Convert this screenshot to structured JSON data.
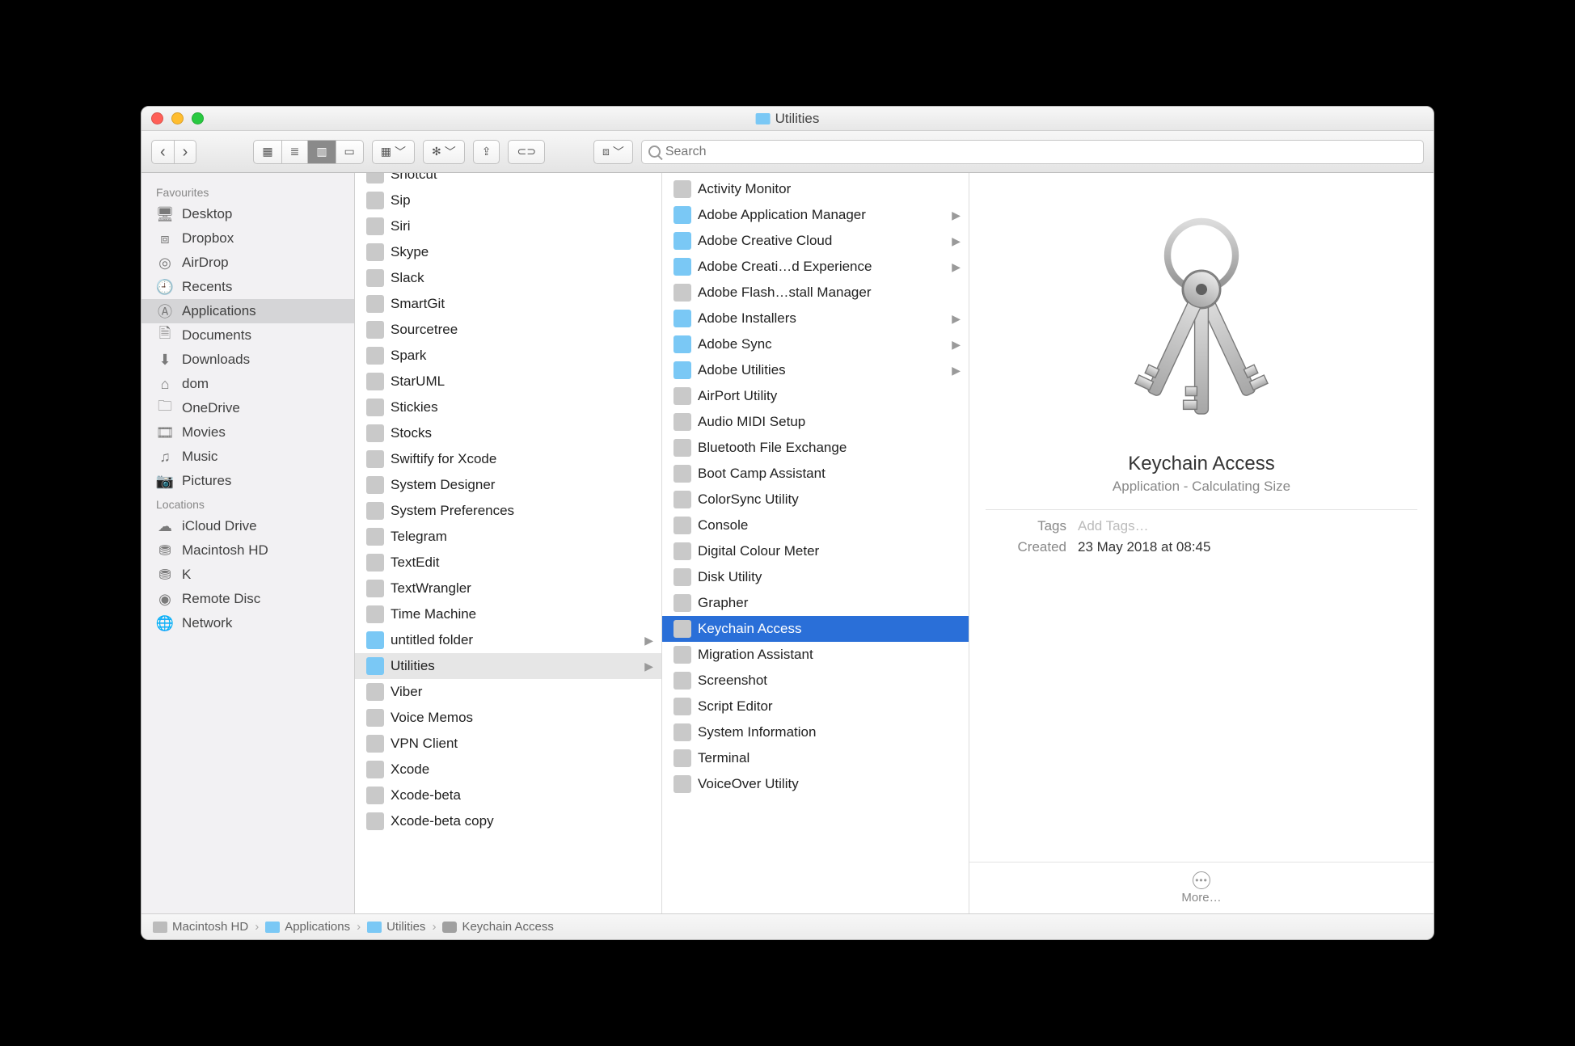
{
  "window": {
    "title": "Utilities"
  },
  "toolbar": {
    "search_placeholder": "Search"
  },
  "sidebar": {
    "sections": [
      {
        "title": "Favourites",
        "items": [
          {
            "label": "Desktop",
            "icon": "desktop"
          },
          {
            "label": "Dropbox",
            "icon": "dropbox"
          },
          {
            "label": "AirDrop",
            "icon": "airdrop"
          },
          {
            "label": "Recents",
            "icon": "recents"
          },
          {
            "label": "Applications",
            "icon": "applications",
            "selected": true
          },
          {
            "label": "Documents",
            "icon": "documents"
          },
          {
            "label": "Downloads",
            "icon": "downloads"
          },
          {
            "label": "dom",
            "icon": "home"
          },
          {
            "label": "OneDrive",
            "icon": "folder"
          },
          {
            "label": "Movies",
            "icon": "movies"
          },
          {
            "label": "Music",
            "icon": "music"
          },
          {
            "label": "Pictures",
            "icon": "pictures"
          }
        ]
      },
      {
        "title": "Locations",
        "items": [
          {
            "label": "iCloud Drive",
            "icon": "icloud"
          },
          {
            "label": "Macintosh HD",
            "icon": "hd"
          },
          {
            "label": "K",
            "icon": "hd"
          },
          {
            "label": "Remote Disc",
            "icon": "disc"
          },
          {
            "label": "Network",
            "icon": "network"
          }
        ]
      }
    ]
  },
  "columns": {
    "col1": [
      {
        "label": "Shotcut"
      },
      {
        "label": "Sip"
      },
      {
        "label": "Siri"
      },
      {
        "label": "Skype"
      },
      {
        "label": "Slack"
      },
      {
        "label": "SmartGit"
      },
      {
        "label": "Sourcetree"
      },
      {
        "label": "Spark"
      },
      {
        "label": "StarUML"
      },
      {
        "label": "Stickies"
      },
      {
        "label": "Stocks"
      },
      {
        "label": "Swiftify for Xcode"
      },
      {
        "label": "System Designer"
      },
      {
        "label": "System Preferences"
      },
      {
        "label": "Telegram"
      },
      {
        "label": "TextEdit"
      },
      {
        "label": "TextWrangler"
      },
      {
        "label": "Time Machine"
      },
      {
        "label": "untitled folder",
        "folder": true
      },
      {
        "label": "Utilities",
        "folder": true,
        "selected": true
      },
      {
        "label": "Viber"
      },
      {
        "label": "Voice Memos"
      },
      {
        "label": "VPN Client"
      },
      {
        "label": "Xcode"
      },
      {
        "label": "Xcode-beta"
      },
      {
        "label": "Xcode-beta copy"
      }
    ],
    "col2": [
      {
        "label": "Activity Monitor"
      },
      {
        "label": "Adobe Application Manager",
        "folder": true
      },
      {
        "label": "Adobe Creative Cloud",
        "folder": true
      },
      {
        "label": "Adobe Creati…d Experience",
        "folder": true
      },
      {
        "label": "Adobe Flash…stall Manager"
      },
      {
        "label": "Adobe Installers",
        "folder": true
      },
      {
        "label": "Adobe Sync",
        "folder": true
      },
      {
        "label": "Adobe Utilities",
        "folder": true
      },
      {
        "label": "AirPort Utility"
      },
      {
        "label": "Audio MIDI Setup"
      },
      {
        "label": "Bluetooth File Exchange"
      },
      {
        "label": "Boot Camp Assistant"
      },
      {
        "label": "ColorSync Utility"
      },
      {
        "label": "Console"
      },
      {
        "label": "Digital Colour Meter"
      },
      {
        "label": "Disk Utility"
      },
      {
        "label": "Grapher"
      },
      {
        "label": "Keychain Access",
        "selected": true
      },
      {
        "label": "Migration Assistant"
      },
      {
        "label": "Screenshot"
      },
      {
        "label": "Script Editor"
      },
      {
        "label": "System Information"
      },
      {
        "label": "Terminal"
      },
      {
        "label": "VoiceOver Utility"
      }
    ]
  },
  "preview": {
    "title": "Keychain Access",
    "subtitle": "Application - Calculating Size",
    "tags_label": "Tags",
    "tags_placeholder": "Add Tags…",
    "created_label": "Created",
    "created_value": "23 May 2018 at 08:45",
    "more_label": "More…"
  },
  "pathbar": {
    "segments": [
      {
        "label": "Macintosh HD",
        "icon": "hd"
      },
      {
        "label": "Applications",
        "icon": "folder"
      },
      {
        "label": "Utilities",
        "icon": "folder"
      },
      {
        "label": "Keychain Access",
        "icon": "app"
      }
    ]
  }
}
